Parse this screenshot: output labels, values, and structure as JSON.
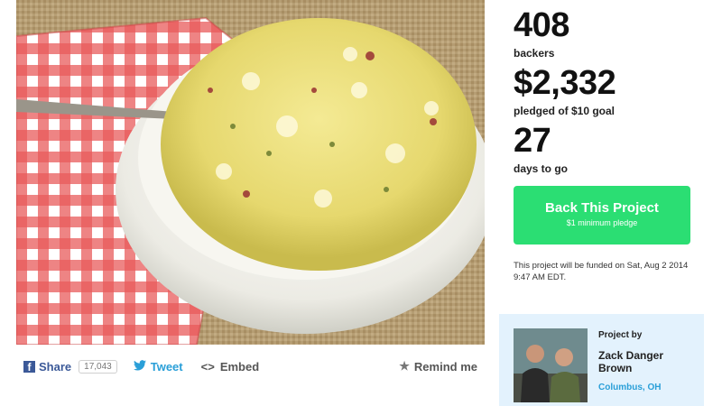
{
  "share": {
    "facebook_label": "Share",
    "facebook_count": "17,043",
    "tweet_label": "Tweet",
    "embed_label": "Embed",
    "remind_label": "Remind me"
  },
  "stats": {
    "backers_value": "408",
    "backers_label": "backers",
    "pledged_value": "$2,332",
    "pledged_label": "pledged of $10 goal",
    "days_value": "27",
    "days_label": "days to go"
  },
  "back_button": {
    "label": "Back This Project",
    "sublabel": "$1 minimum pledge",
    "color": "#2bde73"
  },
  "funding_note": "This project will be funded on Sat, Aug 2 2014 9:47 AM EDT.",
  "creator": {
    "heading": "Project by",
    "name": "Zack Danger Brown",
    "location": "Columbus, OH"
  },
  "colors": {
    "facebook": "#3b5998",
    "twitter": "#2a9fd8",
    "creator_bg": "#e3f2fd"
  },
  "icons": [
    "facebook-icon",
    "twitter-icon",
    "embed-icon",
    "star-icon"
  ]
}
